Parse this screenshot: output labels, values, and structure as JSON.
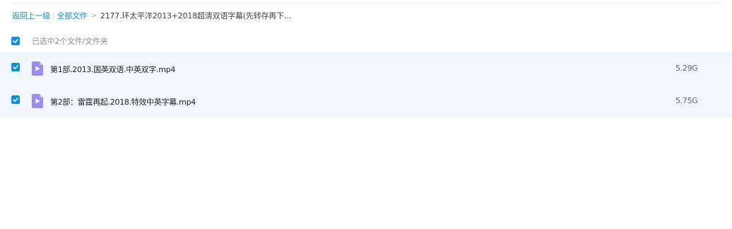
{
  "breadcrumb": {
    "back_label": "返回上一级",
    "all_files_label": "全部文件",
    "arrow": ">",
    "current_folder": "2177.环太平洋2013+2018超清双语字幕(先转存再下..."
  },
  "selection": {
    "checked": true,
    "summary_text": "已选中2个文件/文件夹"
  },
  "files": [
    {
      "name": "第1部.2013.国英双语.中英双字.mp4",
      "size": "5.29G",
      "type_icon": "video-file-icon",
      "checked": true
    },
    {
      "name": "第2部：雷霆再起.2018.特效中英字幕.mp4",
      "size": "5.75G",
      "type_icon": "video-file-icon",
      "checked": true
    }
  ],
  "colors": {
    "accent": "#0a8ee6",
    "row_highlight": "#f1f7fd",
    "video_icon": "#9b8cf2"
  }
}
